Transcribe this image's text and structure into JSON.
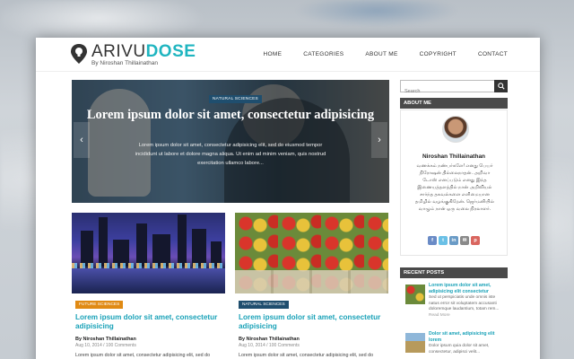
{
  "header": {
    "logo_main": "ARIVU",
    "logo_accent": "DOSE",
    "logo_sub": "By Niroshan Thillainathan",
    "nav": [
      "HOME",
      "CATEGORIES",
      "ABOUT ME",
      "COPYRIGHT",
      "CONTACT"
    ]
  },
  "slider": {
    "category": "NATURAL SCIENCES",
    "title": "Lorem ipsum dolor sit amet, consectetur adipisicing",
    "text": "Lorem ipsum dolor sit amet, consectetur adipisicing elit, sed do eiusmod tempor incididunt ut labore et dolore magna aliqua. Ut enim ad minim veniam, quis nostrud exercitation ullamco labore...",
    "prev": "‹",
    "next": "›"
  },
  "posts": [
    {
      "category": "FUTURE SCIENCES",
      "category_color": "#e08a14",
      "title": "Lorem ipsum dolor sit amet, consectetur adipisicing",
      "author": "By Niroshan Thillainathan",
      "meta": "Aug 10, 2014 / 100 Comments",
      "excerpt": "Lorem ipsum dolor sit amet, consectetur adipisicing elit, sed do eiusmod tempor incididunt ut labore et dolore magna aliqua. Ut enim ad minim"
    },
    {
      "category": "NATURAL SCIENCES",
      "category_color": "#1f4e6e",
      "title": "Lorem ipsum dolor sit amet, consectetur adipisicing",
      "author": "By Niroshan Thillainathan",
      "meta": "Aug 10, 2014 / 100 Comments",
      "excerpt": "Lorem ipsum dolor sit amet, consectetur adipisicing elit, sed do eiusmod tempor incididunt ut labore et dolore magna aliqua. Ut enim ad minim"
    }
  ],
  "sidebar": {
    "search_placeholder": "Search",
    "about_heading": "ABOUT ME",
    "about_name": "Niroshan Thillainathan",
    "about_text": "வணக்கம் நண்பர்களே! எனது பெயர் நிரோஷன் தில்லைநாதன். அறிவா டோஸ் எனப்படும் எனது இந்த இணையத்தளத்தில் நான் அறிவியல் சார்ந்த தகவல்களை எளிமையான தமிழில் வழங்குகிறேன். ஜெர்மனியில் வாழும் நான் ஒரு வலை நிரலாளர்.",
    "socials": [
      {
        "icon": "f",
        "color": "#6a8bc6"
      },
      {
        "icon": "t",
        "color": "#6ac0e6"
      },
      {
        "icon": "in",
        "color": "#6a9bc6"
      },
      {
        "icon": "✉",
        "color": "#8a8a8a"
      },
      {
        "icon": "p",
        "color": "#d9665f"
      }
    ],
    "recent_heading": "RECENT POSTS",
    "recent": [
      {
        "title": "Lorem ipsum dolor sit amet, adipisicing elit consectetur",
        "excerpt": "Sed ut perspiciatis unde omnis iste natus error sit voluptatem accusanti doloremque laudantium, totam rem...",
        "more": "Read More"
      },
      {
        "title": "Dolor sit amet, adipisicing elit lorem",
        "excerpt": "Dolor ipsum quia dolor sit amet, consectetur, adipisci velit...",
        "more": ""
      }
    ]
  }
}
